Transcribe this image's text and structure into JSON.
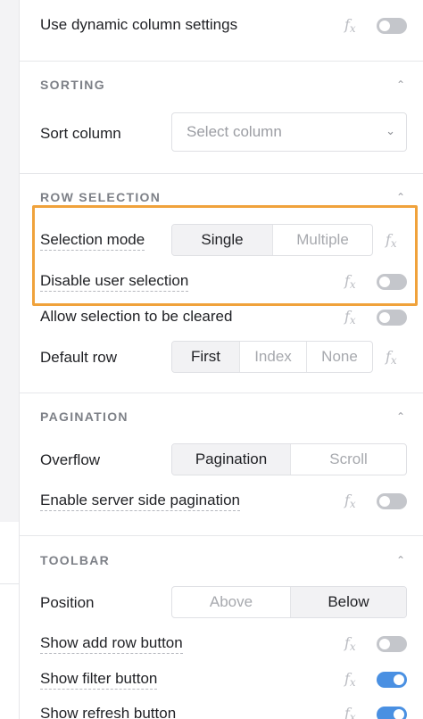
{
  "top": {
    "dynamic_settings_label": "Use dynamic column settings"
  },
  "fx_label": "f",
  "fx_sub": "x",
  "sorting": {
    "title": "SORTING",
    "sort_column_label": "Sort column",
    "sort_column_placeholder": "Select column"
  },
  "row_selection": {
    "title": "ROW SELECTION",
    "selection_mode_label": "Selection mode",
    "selection_mode_options": [
      "Single",
      "Multiple"
    ],
    "disable_user_selection_label": "Disable user selection",
    "allow_cleared_label": "Allow selection to be cleared",
    "default_row_label": "Default row",
    "default_row_options": [
      "First",
      "Index",
      "None"
    ]
  },
  "pagination": {
    "title": "PAGINATION",
    "overflow_label": "Overflow",
    "overflow_options": [
      "Pagination",
      "Scroll"
    ],
    "server_side_label": "Enable server side pagination"
  },
  "toolbar": {
    "title": "TOOLBAR",
    "position_label": "Position",
    "position_options": [
      "Above",
      "Below"
    ],
    "show_add_row_label": "Show add row button",
    "show_filter_label": "Show filter button",
    "show_refresh_label": "Show refresh button"
  },
  "colors": {
    "highlight": "#f0a23b",
    "toggle_on": "#4a90e2",
    "toggle_off": "#c4c6cb"
  },
  "icons": {
    "collapse": "chevron-up-icon",
    "dropdown": "chevron-down-icon",
    "formula": "fx-icon"
  }
}
